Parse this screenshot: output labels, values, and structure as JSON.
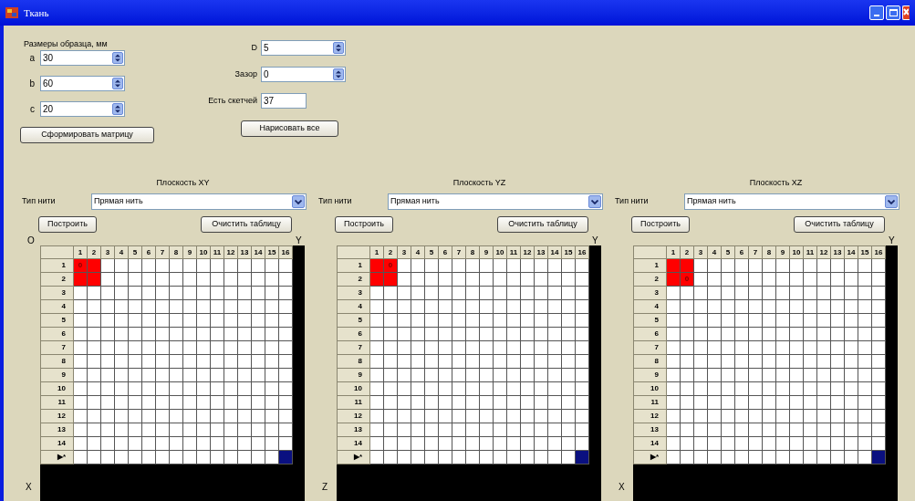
{
  "window": {
    "title": "Ткань"
  },
  "sample": {
    "label": "Размеры образца, мм",
    "fields": [
      {
        "label": "a",
        "value": "30"
      },
      {
        "label": "b",
        "value": "60"
      },
      {
        "label": "c",
        "value": "20"
      }
    ]
  },
  "params": [
    {
      "kind": "spin",
      "label": "D",
      "value": "5"
    },
    {
      "kind": "spin",
      "label": "Зазор",
      "value": "0"
    },
    {
      "kind": "text",
      "label": "Есть скетчей",
      "value": "37"
    }
  ],
  "buttons": [
    "Сформировать матрицу",
    "Нарисовать все"
  ],
  "planes": [
    {
      "title": "Плоскость XY",
      "thread_label": "Тип нити",
      "thread_type": "Прямая нить",
      "build_button": "Построить",
      "clear_button": "Очистить таблицу",
      "origin_label": "O",
      "top_axis": "Y",
      "bottom_axis": "X",
      "columns": [
        "1",
        "2",
        "3",
        "4",
        "5",
        "6",
        "7",
        "8",
        "9",
        "10",
        "11",
        "12",
        "13",
        "14",
        "15",
        "16"
      ],
      "rows": [
        {
          "header": "1",
          "cells": [
            {
              "text": "0",
              "color": "#ff0000",
              "selected": false
            },
            {
              "color": "#ff0000",
              "selected": false
            }
          ]
        },
        {
          "header": "2",
          "cells": [
            {
              "color": "#ff0000",
              "selected": false
            },
            {
              "color": "#ff0000",
              "selected": false
            }
          ]
        },
        {
          "header": "3"
        },
        {
          "header": "4"
        },
        {
          "header": "5"
        },
        {
          "header": "6"
        },
        {
          "header": "7"
        },
        {
          "header": "8"
        },
        {
          "header": "9"
        },
        {
          "header": "10"
        },
        {
          "header": "11"
        },
        {
          "header": "12"
        },
        {
          "header": "13"
        },
        {
          "header": "14"
        },
        {
          "header": "▶*",
          "cells": [
            {
              "selected": false
            },
            {
              "selected": false
            },
            {
              "selected": false
            },
            {
              "selected": false
            },
            {
              "selected": false
            },
            {
              "selected": false
            },
            {
              "selected": false
            },
            {
              "selected": false
            },
            {
              "selected": false
            },
            {
              "selected": false
            },
            {
              "selected": false
            },
            {
              "selected": false
            },
            {
              "selected": false
            },
            {
              "selected": false
            },
            {
              "selected": false
            },
            {
              "selected": true
            }
          ]
        }
      ]
    },
    {
      "title": "Плоскость YZ",
      "thread_label": "Тип нити",
      "thread_type": "Прямая нить",
      "build_button": "Построить",
      "clear_button": "Очистить таблицу",
      "top_axis": "Y",
      "bottom_axis": "Z",
      "columns": [
        "1",
        "2",
        "3",
        "4",
        "5",
        "6",
        "7",
        "8",
        "9",
        "10",
        "11",
        "12",
        "13",
        "14",
        "15",
        "16"
      ],
      "rows": [
        {
          "header": "1",
          "cells": [
            {
              "color": "#ff0000",
              "selected": false
            },
            {
              "text": "0",
              "color": "#ff0000",
              "selected": false
            }
          ]
        },
        {
          "header": "2",
          "cells": [
            {
              "color": "#ff0000",
              "selected": false
            },
            {
              "color": "#ff0000",
              "selected": false
            }
          ]
        },
        {
          "header": "3"
        },
        {
          "header": "4"
        },
        {
          "header": "5"
        },
        {
          "header": "6"
        },
        {
          "header": "7"
        },
        {
          "header": "8"
        },
        {
          "header": "9"
        },
        {
          "header": "10"
        },
        {
          "header": "11"
        },
        {
          "header": "12"
        },
        {
          "header": "13"
        },
        {
          "header": "14"
        },
        {
          "header": "▶*",
          "cells": [
            {
              "selected": false
            },
            {
              "selected": false
            },
            {
              "selected": false
            },
            {
              "selected": false
            },
            {
              "selected": false
            },
            {
              "selected": false
            },
            {
              "selected": false
            },
            {
              "selected": false
            },
            {
              "selected": false
            },
            {
              "selected": false
            },
            {
              "selected": false
            },
            {
              "selected": false
            },
            {
              "selected": false
            },
            {
              "selected": false
            },
            {
              "selected": false
            },
            {
              "selected": true
            }
          ]
        }
      ]
    },
    {
      "title": "Плоскость XZ",
      "thread_label": "Тип нити",
      "thread_type": "Прямая нить",
      "build_button": "Построить",
      "clear_button": "Очистить таблицу",
      "top_axis": "Y",
      "bottom_axis": "X",
      "columns": [
        "1",
        "2",
        "3",
        "4",
        "5",
        "6",
        "7",
        "8",
        "9",
        "10",
        "11",
        "12",
        "13",
        "14",
        "15",
        "16"
      ],
      "rows": [
        {
          "header": "1",
          "cells": [
            {
              "color": "#ff0000",
              "selected": false
            },
            {
              "color": "#ff0000",
              "selected": false
            }
          ]
        },
        {
          "header": "2",
          "cells": [
            {
              "color": "#ff0000",
              "selected": false
            },
            {
              "text": "0",
              "color": "#ff0000",
              "selected": false
            }
          ]
        },
        {
          "header": "3"
        },
        {
          "header": "4"
        },
        {
          "header": "5"
        },
        {
          "header": "6"
        },
        {
          "header": "7"
        },
        {
          "header": "8"
        },
        {
          "header": "9"
        },
        {
          "header": "10"
        },
        {
          "header": "11"
        },
        {
          "header": "12"
        },
        {
          "header": "13"
        },
        {
          "header": "14"
        },
        {
          "header": "▶*",
          "cells": [
            {
              "selected": false
            },
            {
              "selected": false
            },
            {
              "selected": false
            },
            {
              "selected": false
            },
            {
              "selected": false
            },
            {
              "selected": false
            },
            {
              "selected": false
            },
            {
              "selected": false
            },
            {
              "selected": false
            },
            {
              "selected": false
            },
            {
              "selected": false
            },
            {
              "selected": false
            },
            {
              "selected": false
            },
            {
              "selected": false
            },
            {
              "selected": false
            },
            {
              "selected": true
            }
          ]
        }
      ]
    }
  ]
}
